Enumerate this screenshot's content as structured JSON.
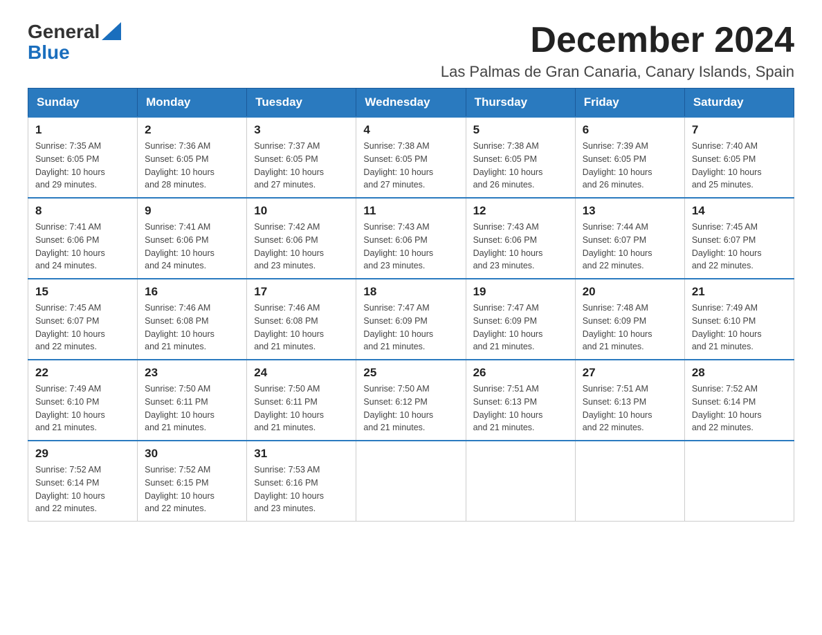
{
  "logo": {
    "text_general": "General",
    "text_blue": "Blue"
  },
  "header": {
    "month_year": "December 2024",
    "location": "Las Palmas de Gran Canaria, Canary Islands, Spain"
  },
  "weekdays": [
    "Sunday",
    "Monday",
    "Tuesday",
    "Wednesday",
    "Thursday",
    "Friday",
    "Saturday"
  ],
  "weeks": [
    [
      {
        "day": "1",
        "sunrise": "7:35 AM",
        "sunset": "6:05 PM",
        "daylight": "10 hours and 29 minutes."
      },
      {
        "day": "2",
        "sunrise": "7:36 AM",
        "sunset": "6:05 PM",
        "daylight": "10 hours and 28 minutes."
      },
      {
        "day": "3",
        "sunrise": "7:37 AM",
        "sunset": "6:05 PM",
        "daylight": "10 hours and 27 minutes."
      },
      {
        "day": "4",
        "sunrise": "7:38 AM",
        "sunset": "6:05 PM",
        "daylight": "10 hours and 27 minutes."
      },
      {
        "day": "5",
        "sunrise": "7:38 AM",
        "sunset": "6:05 PM",
        "daylight": "10 hours and 26 minutes."
      },
      {
        "day": "6",
        "sunrise": "7:39 AM",
        "sunset": "6:05 PM",
        "daylight": "10 hours and 26 minutes."
      },
      {
        "day": "7",
        "sunrise": "7:40 AM",
        "sunset": "6:05 PM",
        "daylight": "10 hours and 25 minutes."
      }
    ],
    [
      {
        "day": "8",
        "sunrise": "7:41 AM",
        "sunset": "6:06 PM",
        "daylight": "10 hours and 24 minutes."
      },
      {
        "day": "9",
        "sunrise": "7:41 AM",
        "sunset": "6:06 PM",
        "daylight": "10 hours and 24 minutes."
      },
      {
        "day": "10",
        "sunrise": "7:42 AM",
        "sunset": "6:06 PM",
        "daylight": "10 hours and 23 minutes."
      },
      {
        "day": "11",
        "sunrise": "7:43 AM",
        "sunset": "6:06 PM",
        "daylight": "10 hours and 23 minutes."
      },
      {
        "day": "12",
        "sunrise": "7:43 AM",
        "sunset": "6:06 PM",
        "daylight": "10 hours and 23 minutes."
      },
      {
        "day": "13",
        "sunrise": "7:44 AM",
        "sunset": "6:07 PM",
        "daylight": "10 hours and 22 minutes."
      },
      {
        "day": "14",
        "sunrise": "7:45 AM",
        "sunset": "6:07 PM",
        "daylight": "10 hours and 22 minutes."
      }
    ],
    [
      {
        "day": "15",
        "sunrise": "7:45 AM",
        "sunset": "6:07 PM",
        "daylight": "10 hours and 22 minutes."
      },
      {
        "day": "16",
        "sunrise": "7:46 AM",
        "sunset": "6:08 PM",
        "daylight": "10 hours and 21 minutes."
      },
      {
        "day": "17",
        "sunrise": "7:46 AM",
        "sunset": "6:08 PM",
        "daylight": "10 hours and 21 minutes."
      },
      {
        "day": "18",
        "sunrise": "7:47 AM",
        "sunset": "6:09 PM",
        "daylight": "10 hours and 21 minutes."
      },
      {
        "day": "19",
        "sunrise": "7:47 AM",
        "sunset": "6:09 PM",
        "daylight": "10 hours and 21 minutes."
      },
      {
        "day": "20",
        "sunrise": "7:48 AM",
        "sunset": "6:09 PM",
        "daylight": "10 hours and 21 minutes."
      },
      {
        "day": "21",
        "sunrise": "7:49 AM",
        "sunset": "6:10 PM",
        "daylight": "10 hours and 21 minutes."
      }
    ],
    [
      {
        "day": "22",
        "sunrise": "7:49 AM",
        "sunset": "6:10 PM",
        "daylight": "10 hours and 21 minutes."
      },
      {
        "day": "23",
        "sunrise": "7:50 AM",
        "sunset": "6:11 PM",
        "daylight": "10 hours and 21 minutes."
      },
      {
        "day": "24",
        "sunrise": "7:50 AM",
        "sunset": "6:11 PM",
        "daylight": "10 hours and 21 minutes."
      },
      {
        "day": "25",
        "sunrise": "7:50 AM",
        "sunset": "6:12 PM",
        "daylight": "10 hours and 21 minutes."
      },
      {
        "day": "26",
        "sunrise": "7:51 AM",
        "sunset": "6:13 PM",
        "daylight": "10 hours and 21 minutes."
      },
      {
        "day": "27",
        "sunrise": "7:51 AM",
        "sunset": "6:13 PM",
        "daylight": "10 hours and 22 minutes."
      },
      {
        "day": "28",
        "sunrise": "7:52 AM",
        "sunset": "6:14 PM",
        "daylight": "10 hours and 22 minutes."
      }
    ],
    [
      {
        "day": "29",
        "sunrise": "7:52 AM",
        "sunset": "6:14 PM",
        "daylight": "10 hours and 22 minutes."
      },
      {
        "day": "30",
        "sunrise": "7:52 AM",
        "sunset": "6:15 PM",
        "daylight": "10 hours and 22 minutes."
      },
      {
        "day": "31",
        "sunrise": "7:53 AM",
        "sunset": "6:16 PM",
        "daylight": "10 hours and 23 minutes."
      },
      null,
      null,
      null,
      null
    ]
  ],
  "labels": {
    "sunrise": "Sunrise:",
    "sunset": "Sunset:",
    "daylight": "Daylight:"
  }
}
